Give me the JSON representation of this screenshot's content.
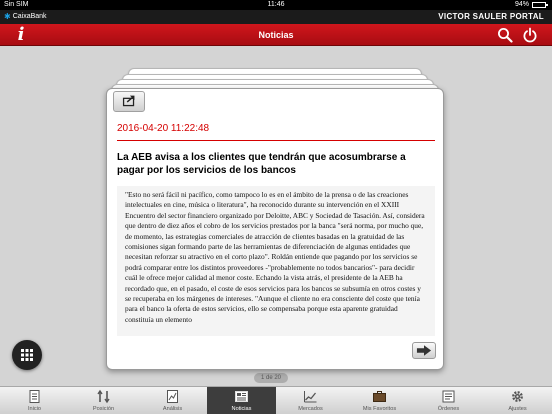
{
  "status_bar": {
    "carrier": "Sin SIM",
    "time": "11:46",
    "battery": "94%"
  },
  "brand_bar": {
    "bank": "CaixaBank",
    "user": "VICTOR SAULER PORTAL"
  },
  "app_bar": {
    "title": "Noticias",
    "info_glyph": "i"
  },
  "article": {
    "date": "2016-04-20 11:22:48",
    "headline": "La AEB avisa a los clientes que tendrán que acosumbrarse a pagar por los servicios de los bancos",
    "body": "\"Esto no será fácil ni pacífico, como tampoco lo es en el ámbito de la prensa o de las creaciones intelectuales en cine, música o literatura\", ha reconocido durante su intervención en el XXIII Encuentro del sector financiero organizado por Deloitte, ABC y Sociedad de Tasación. Así, considera que dentro de diez años el cobro de los servicios prestados por la banca \"será norma, por mucho que, de momento, las estrategias comerciales de atracción de clientes basadas en la gratuidad de las comisiones sigan formando parte de las herramientas de diferenciación de algunas entidades que necesitan reforzar su atractivo en el corto plazo\". Roldán entiende que pagando por los servicios se podrá comparar entre los distintos proveedores -\"probablemente no todos bancarios\"- para decidir cuál le ofrece mejor calidad al menor coste. Echando la vista atrás, el presidente de la AEB ha recordado que, en el pasado, el coste de esos servicios para los bancos se subsumía en otros costes y se recuperaba en los márgenes de intereses. \"Aunque el cliente no era consciente del coste que tenía para el banco la oferta de estos servicios, ello se compensaba porque esta aparente gratuidad constituía un elemento"
  },
  "pager": {
    "text": "1 de 20"
  },
  "tabs": [
    {
      "label": "Inicio",
      "icon": "document-icon"
    },
    {
      "label": "Posición",
      "icon": "position-icon"
    },
    {
      "label": "Análisis",
      "icon": "analysis-icon"
    },
    {
      "label": "Noticias",
      "icon": "news-icon",
      "active": true
    },
    {
      "label": "Mercados",
      "icon": "markets-icon"
    },
    {
      "label": "Mis Favoritos",
      "icon": "briefcase-icon"
    },
    {
      "label": "Órdenes",
      "icon": "orders-icon"
    },
    {
      "label": "Ajustes",
      "icon": "gear-icon"
    }
  ],
  "colors": {
    "accent_red": "#c8141a",
    "date_red": "#d50000",
    "tab_active": "#3d3d3d"
  }
}
